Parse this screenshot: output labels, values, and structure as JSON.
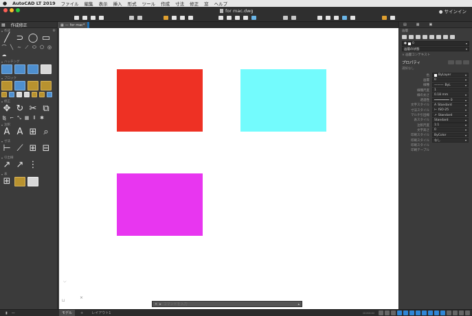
{
  "menubar": {
    "apple": "",
    "app_name": "AutoCAD LT 2019",
    "items": [
      "ファイル",
      "編集",
      "表示",
      "挿入",
      "形式",
      "ツール",
      "作成",
      "寸法",
      "修正",
      "窓",
      "ヘルプ"
    ],
    "signin": "サインイン"
  },
  "window": {
    "doc_title": "for mac.dwg"
  },
  "left_panel": {
    "tab_label": "作成修正",
    "sections": {
      "draw": "作成",
      "hatch": "ハッチング",
      "block": "ブロック",
      "modify": "修正",
      "annotation": "注釈",
      "dimension": "寸法",
      "leader": "引出線",
      "table": "表"
    }
  },
  "doc_tab": {
    "label": "for mac*"
  },
  "canvas": {
    "shapes": [
      {
        "name": "red-rectangle",
        "color": "#ee3124"
      },
      {
        "name": "cyan-rectangle",
        "color": "#73fbfd"
      },
      {
        "name": "magenta-rectangle",
        "color": "#e836f0"
      }
    ],
    "cursor_glyph": "×"
  },
  "command_line": {
    "placeholder": "コマンドを入力"
  },
  "right_panel": {
    "tabs": [
      "",
      "",
      ""
    ],
    "layer_label": "画層",
    "layer_value": "0",
    "dropdown_value": "画層の状態",
    "isolate_label": "画層コンテキスト",
    "properties_title": "プロパティ",
    "no_selection": "選択なし",
    "rows": [
      {
        "key": "色",
        "value": "ByLayer",
        "swatch": "#ffffff"
      },
      {
        "key": "画層",
        "value": "0"
      },
      {
        "key": "線種",
        "value": "ByL"
      },
      {
        "key": "線種尺度",
        "value": "1"
      },
      {
        "key": "線の太さ",
        "value": "0.18 mm"
      },
      {
        "key": "透過性",
        "value": "0"
      },
      {
        "key": "文字スタイル",
        "value": "Standard"
      },
      {
        "key": "寸法スタイル",
        "value": "ISO-25"
      },
      {
        "key": "マルチ引出線",
        "value": "Standard"
      },
      {
        "key": "表スタイル",
        "value": "Standard"
      },
      {
        "key": "注釈尺度",
        "value": "1:1"
      },
      {
        "key": "文字高さ",
        "value": "0"
      },
      {
        "key": "印刷スタイル",
        "value": "ByColor"
      },
      {
        "key": "印刷スタイル",
        "value": "なし"
      },
      {
        "key": "印刷スタイル",
        "value": ""
      },
      {
        "key": "印刷テーブル",
        "value": ""
      }
    ]
  },
  "statusbar": {
    "left_icon": "",
    "left_minus": "—",
    "tabs": [
      "モデル",
      "+",
      "レイアウト1"
    ]
  },
  "colors": {
    "accent": "#2f86d6",
    "panel_bg": "#3b3b3b",
    "canvas_bg": "#ffffff"
  }
}
